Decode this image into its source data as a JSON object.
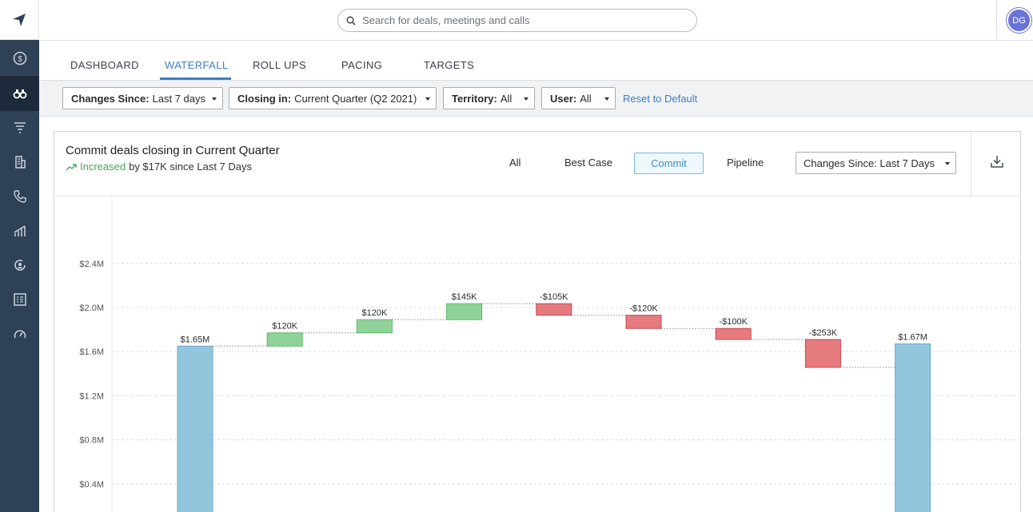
{
  "search": {
    "placeholder": "Search for deals, meetings and calls"
  },
  "user": {
    "initials": "DG"
  },
  "tabs": [
    {
      "label": "DASHBOARD",
      "active": false
    },
    {
      "label": "WATERFALL",
      "active": true
    },
    {
      "label": "ROLL UPS",
      "active": false
    },
    {
      "label": "PACING",
      "active": false
    },
    {
      "label": "TARGETS",
      "active": false
    }
  ],
  "filters": [
    {
      "key": "Changes Since:",
      "value": "Last 7 days"
    },
    {
      "key": "Closing in:",
      "value": "Current Quarter (Q2 2021)"
    },
    {
      "key": "Territory:",
      "value": "All"
    },
    {
      "key": "User:",
      "value": "All"
    }
  ],
  "reset_label": "Reset to Default",
  "card": {
    "title": "Commit deals closing in Current Quarter",
    "increase_word": "Increased",
    "increase_rest": "by $17K since Last 7 Days",
    "category_tabs": [
      "All",
      "Best Case",
      "Commit",
      "Pipeline"
    ],
    "active_category": "Commit",
    "changes_dropdown": "Changes Since: Last 7 Days"
  },
  "colors": {
    "accent": "#3d7fc2",
    "increase": "#8fd39a",
    "decrease": "#e57a7f",
    "total": "#92c6dd",
    "sidebar": "#2f4157"
  },
  "chart_data": {
    "type": "waterfall",
    "yticks": [
      "$0.4M",
      "$0.8M",
      "$1.2M",
      "$1.6M",
      "$2.0M",
      "$2.4M"
    ],
    "ytick_values": [
      0.4,
      0.8,
      1.2,
      1.6,
      2.0,
      2.4
    ],
    "y_unit": "$M",
    "bars": [
      {
        "kind": "total",
        "label": "$1.65M",
        "value": 1.65
      },
      {
        "kind": "increase",
        "label": "$120K",
        "value": 0.12
      },
      {
        "kind": "increase",
        "label": "$120K",
        "value": 0.12
      },
      {
        "kind": "increase",
        "label": "$145K",
        "value": 0.145
      },
      {
        "kind": "decrease",
        "label": "-$105K",
        "value": -0.105
      },
      {
        "kind": "decrease",
        "label": "-$120K",
        "value": -0.12
      },
      {
        "kind": "decrease",
        "label": "-$100K",
        "value": -0.1
      },
      {
        "kind": "decrease",
        "label": "-$253K",
        "value": -0.253
      },
      {
        "kind": "total",
        "label": "$1.67M",
        "value": 1.67
      }
    ]
  }
}
